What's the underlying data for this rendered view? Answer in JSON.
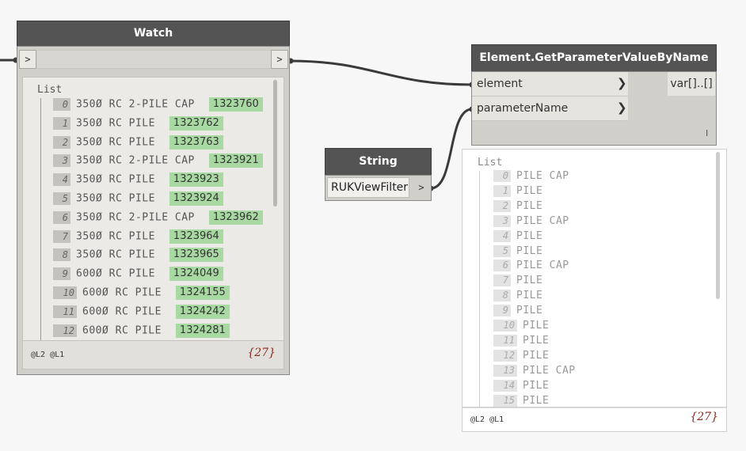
{
  "watch_node": {
    "title": "Watch",
    "in_port": ">",
    "out_port": ">",
    "list_label": "List",
    "items": [
      {
        "index": "0",
        "name": "350Ø RC 2-PILE CAP",
        "id": "1323760"
      },
      {
        "index": "1",
        "name": "350Ø RC PILE",
        "id": "1323762"
      },
      {
        "index": "2",
        "name": "350Ø RC PILE",
        "id": "1323763"
      },
      {
        "index": "3",
        "name": "350Ø RC 2-PILE CAP",
        "id": "1323921"
      },
      {
        "index": "4",
        "name": "350Ø RC PILE",
        "id": "1323923"
      },
      {
        "index": "5",
        "name": "350Ø RC PILE",
        "id": "1323924"
      },
      {
        "index": "6",
        "name": "350Ø RC 2-PILE CAP",
        "id": "1323962"
      },
      {
        "index": "7",
        "name": "350Ø RC PILE",
        "id": "1323964"
      },
      {
        "index": "8",
        "name": "350Ø RC PILE",
        "id": "1323965"
      },
      {
        "index": "9",
        "name": "600Ø RC PILE",
        "id": "1324049"
      },
      {
        "index": "10",
        "name": "600Ø RC PILE",
        "id": "1324155"
      },
      {
        "index": "11",
        "name": "600Ø RC PILE",
        "id": "1324242"
      },
      {
        "index": "12",
        "name": "600Ø RC PILE",
        "id": "1324281"
      }
    ],
    "levels": "@L2 @L1",
    "count": "{27}"
  },
  "get_param_node": {
    "title": "Element.GetParameterValueByName",
    "inputs": [
      "element",
      "parameterName"
    ],
    "input_arrow": "❯",
    "output": "var[]..[]",
    "lacing": "I"
  },
  "string_node": {
    "title": "String",
    "value": "RUKViewFilter",
    "out_port": ">"
  },
  "preview": {
    "list_label": "List",
    "items": [
      {
        "index": "0",
        "value": "PILE CAP"
      },
      {
        "index": "1",
        "value": "PILE"
      },
      {
        "index": "2",
        "value": "PILE"
      },
      {
        "index": "3",
        "value": "PILE CAP"
      },
      {
        "index": "4",
        "value": "PILE"
      },
      {
        "index": "5",
        "value": "PILE"
      },
      {
        "index": "6",
        "value": "PILE CAP"
      },
      {
        "index": "7",
        "value": "PILE"
      },
      {
        "index": "8",
        "value": "PILE"
      },
      {
        "index": "9",
        "value": "PILE"
      },
      {
        "index": "10",
        "value": "PILE"
      },
      {
        "index": "11",
        "value": "PILE"
      },
      {
        "index": "12",
        "value": "PILE"
      },
      {
        "index": "13",
        "value": "PILE CAP"
      },
      {
        "index": "14",
        "value": "PILE"
      },
      {
        "index": "15",
        "value": "PILE"
      }
    ],
    "levels": "@L2 @L1",
    "count": "{27}"
  },
  "colors": {
    "header": "#545454",
    "node_body": "#d1cfca",
    "id_badge": "#a9d9a3",
    "count_text": "#8b2b1e",
    "wire": "#3a3a3a"
  }
}
